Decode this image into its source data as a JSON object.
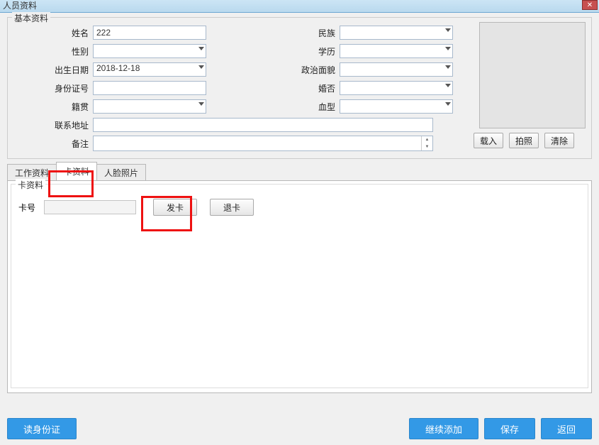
{
  "window": {
    "title": "人员资料"
  },
  "basic": {
    "legend": "基本资料",
    "labels": {
      "name": "姓名",
      "gender": "性别",
      "birth": "出生日期",
      "idno": "身份证号",
      "native": "籍贯",
      "ethnic": "民族",
      "education": "学历",
      "politics": "政治面貌",
      "marriage": "婚否",
      "blood": "血型",
      "address": "联系地址",
      "remark": "备注"
    },
    "values": {
      "name": "222",
      "gender": "",
      "birth": "2018-12-18",
      "idno": "",
      "native": "",
      "ethnic": "",
      "education": "",
      "politics": "",
      "marriage": "",
      "blood": "",
      "address": "",
      "remark": ""
    },
    "img_buttons": {
      "load": "载入",
      "shoot": "拍照",
      "clear": "清除"
    }
  },
  "tabs": {
    "work": "工作资料",
    "card": "卡资料",
    "face": "人脸照片",
    "active": "卡资料"
  },
  "card": {
    "legend": "卡资料",
    "cardno_label": "卡号",
    "cardno_value": "",
    "issue": "发卡",
    "withdraw": "退卡"
  },
  "footer": {
    "read_id": "读身份证",
    "continue_add": "继续添加",
    "save": "保存",
    "back": "返回"
  }
}
